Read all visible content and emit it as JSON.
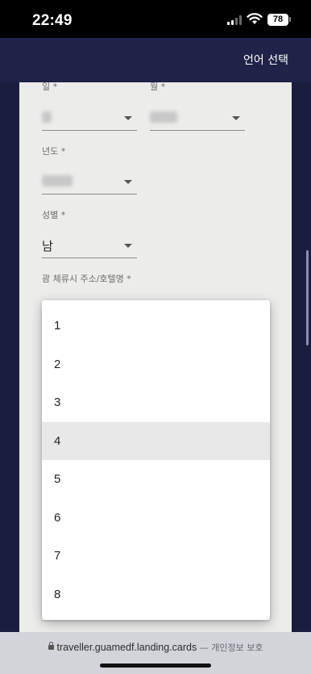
{
  "status_bar": {
    "time": "22:49",
    "battery": "78"
  },
  "header": {
    "language_button": "언어 선택"
  },
  "form": {
    "day": {
      "label": "일 *"
    },
    "month": {
      "label": "월 *"
    },
    "year": {
      "label": "년도 *"
    },
    "gender": {
      "label": "성별 *",
      "value": "남"
    },
    "address": {
      "label": "괌 체류시 주소/호텔명 *"
    }
  },
  "dropdown": {
    "highlighted": "4",
    "options": [
      "1",
      "2",
      "3",
      "4",
      "5",
      "6",
      "7",
      "8"
    ]
  },
  "browser": {
    "url": "traveller.guamedf.landing.cards",
    "note": "— 개인정보 보호"
  }
}
